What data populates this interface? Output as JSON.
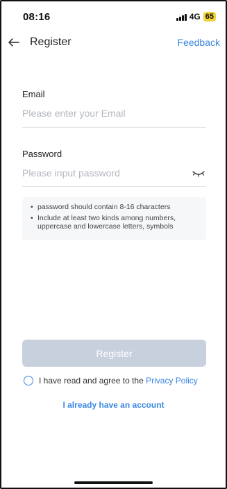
{
  "status_bar": {
    "time": "08:16",
    "network": "4G",
    "battery": "65"
  },
  "header": {
    "back_icon": "arrow-left-icon",
    "title": "Register",
    "feedback": "Feedback"
  },
  "form": {
    "email": {
      "label": "Email",
      "value": "",
      "placeholder": "Please enter your Email"
    },
    "password": {
      "label": "Password",
      "value": "",
      "placeholder": "Please input password",
      "toggle_icon": "eye-closed-icon"
    },
    "hints": [
      "password should contain 8-16 characters",
      "Include at least two kinds among numbers, uppercase and lowercase letters, symbols"
    ]
  },
  "actions": {
    "register_label": "Register",
    "agree_text": "I have read and agree to the",
    "policy_link": "Privacy Policy",
    "account_link": "I already have an account"
  },
  "colors": {
    "accent": "#3a86e0",
    "button_disabled": "#c7d0dc",
    "battery": "#f2d33a"
  }
}
